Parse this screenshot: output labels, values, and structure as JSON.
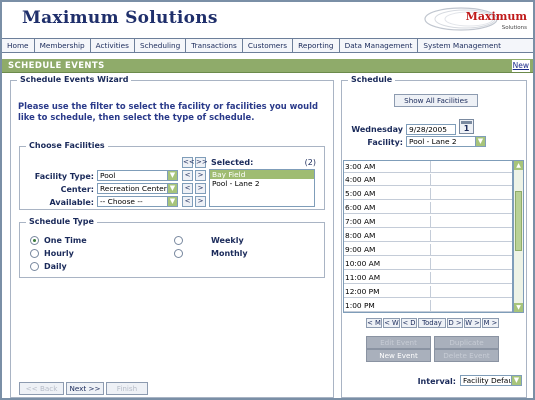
{
  "app": {
    "title": "Maximum Solutions",
    "logo_text": "Maximum",
    "logo_sub": "Solutions"
  },
  "nav": [
    "Home",
    "Membership",
    "Activities",
    "Scheduling",
    "Transactions",
    "Customers",
    "Reporting",
    "Data Management",
    "System Management"
  ],
  "section": {
    "title": "SCHEDULE EVENTS",
    "new_link": "New"
  },
  "wizard": {
    "title": "Schedule Events Wizard",
    "instructions": "Please use the filter to select the facility or facilities you would like to schedule, then select the type of schedule.",
    "choose": {
      "title": "Choose Facilities",
      "facility_type_label": "Facility Type:",
      "facility_type_value": "Pool",
      "center_label": "Center:",
      "center_value": "Recreation Center",
      "available_label": "Available:",
      "available_value": "-- Choose --",
      "move_all_left": "<<",
      "move_all_right": ">>",
      "move_left": "<",
      "move_right": ">",
      "selected_label": "Selected:",
      "selected_count": "(2)",
      "selected_items": [
        "Bay Field",
        "Pool - Lane 2"
      ]
    },
    "type": {
      "title": "Schedule Type",
      "options": [
        "One Time",
        "Hourly",
        "Daily",
        "Weekly",
        "Monthly"
      ],
      "selected": "One Time"
    },
    "buttons": {
      "back": "<< Back",
      "next": "Next >>",
      "finish": "Finish"
    }
  },
  "schedule": {
    "title": "Schedule",
    "show_all": "Show All Facilities",
    "day_label": "Wednesday",
    "date_value": "9/28/2005",
    "cal_day": "1",
    "facility_label": "Facility:",
    "facility_value": "Pool - Lane 2",
    "times": [
      "3:00 AM",
      "4:00 AM",
      "5:00 AM",
      "6:00 AM",
      "7:00 AM",
      "8:00 AM",
      "9:00 AM",
      "10:00 AM",
      "11:00 AM",
      "12:00 PM",
      "1:00 PM"
    ],
    "nav_buttons": [
      "< M",
      "< W",
      "< D",
      "Today",
      "D >",
      "W >",
      "M >"
    ],
    "action_buttons": {
      "edit_event": "Edit Event",
      "delete_event": "Delete Event",
      "new_event": "New Event",
      "duplicate": "Duplicate"
    },
    "interval_label": "Interval:",
    "interval_value": "Facility Default"
  }
}
